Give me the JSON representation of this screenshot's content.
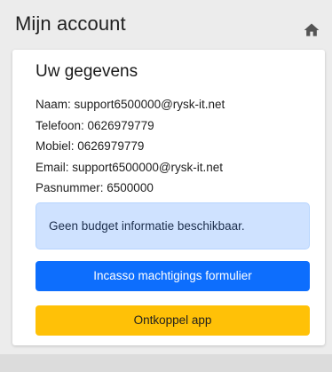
{
  "header": {
    "title": "Mijn account",
    "home_icon": "home-icon"
  },
  "account": {
    "section_title": "Uw gegevens",
    "details": [
      {
        "label": "Naam",
        "value": "support6500000@rysk-it.net",
        "text": "Naam: support6500000@rysk-it.net"
      },
      {
        "label": "Telefoon",
        "value": "0626979779",
        "text": "Telefoon: 0626979779"
      },
      {
        "label": "Mobiel",
        "value": "0626979779",
        "text": "Mobiel: 0626979779"
      },
      {
        "label": "Email",
        "value": "support6500000@rysk-it.net",
        "text": "Email: support6500000@rysk-it.net"
      },
      {
        "label": "Pasnummer",
        "value": "6500000",
        "text": "Pasnummer: 6500000"
      }
    ],
    "budget_alert": "Geen budget informatie beschikbaar.",
    "incasso_button_label": "Incasso machtigings formulier",
    "disconnect_button_label": "Ontkoppel app"
  },
  "colors": {
    "background": "#ececec",
    "card": "#ffffff",
    "alert_bg": "#cfe2ff",
    "primary": "#0d6efd",
    "warning": "#ffc107"
  }
}
